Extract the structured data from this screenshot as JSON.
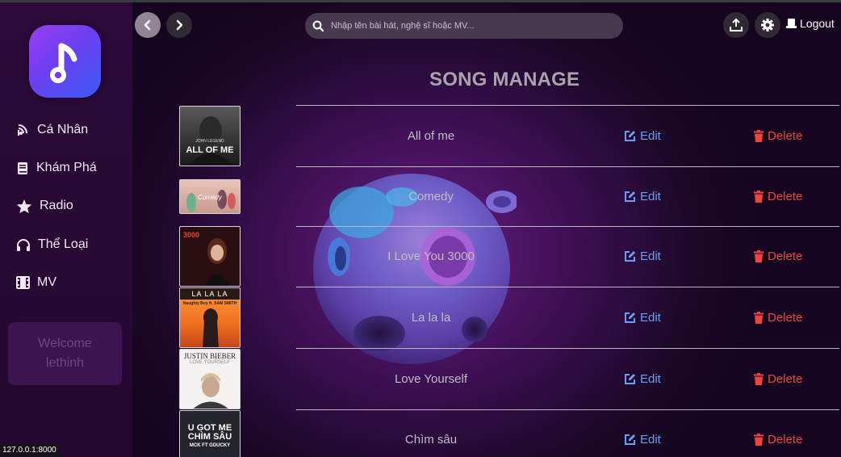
{
  "sidebar": {
    "items": [
      {
        "label": "Cá Nhân",
        "icon": "signal-icon"
      },
      {
        "label": "Khám Phá",
        "icon": "book-icon"
      },
      {
        "label": "Radio",
        "icon": "star-icon"
      },
      {
        "label": "Thể Loại",
        "icon": "headphones-icon"
      },
      {
        "label": "MV",
        "icon": "film-icon"
      }
    ],
    "welcome_line1": "Welcome",
    "welcome_line2": "lethinh"
  },
  "header": {
    "search_placeholder": "Nhập tên bài hát, nghệ sĩ hoặc MV...",
    "logout_label": "Logout"
  },
  "page": {
    "title": "SONG MANAGE"
  },
  "songs": [
    {
      "title": "All of me",
      "cover_text": "ALL OF ME",
      "cover_sub": "JOHN LEGEND"
    },
    {
      "title": "Comedy",
      "cover_text": "Comedy"
    },
    {
      "title": "I Love You 3000",
      "cover_text": "3000"
    },
    {
      "title": "La la la",
      "cover_text": "LA LA LA",
      "cover_sub": "Naughty Boy ft. SAM SMITH"
    },
    {
      "title": "Love Yourself",
      "cover_text": "JUSTIN BIEBER",
      "cover_sub": "LOVE YOURSELF"
    },
    {
      "title": "Chìm sâu",
      "cover_text": "U GOT ME CHÌM SÂU",
      "cover_sub": "MCK FT GDUCKY"
    }
  ],
  "actions": {
    "edit_label": "Edit",
    "delete_label": "Delete"
  },
  "statusbar": {
    "url": "127.0.0.1:8000"
  },
  "colors": {
    "edit": "#6b9ff5",
    "delete": "#f0453f",
    "accent": "#7b3ff0"
  }
}
